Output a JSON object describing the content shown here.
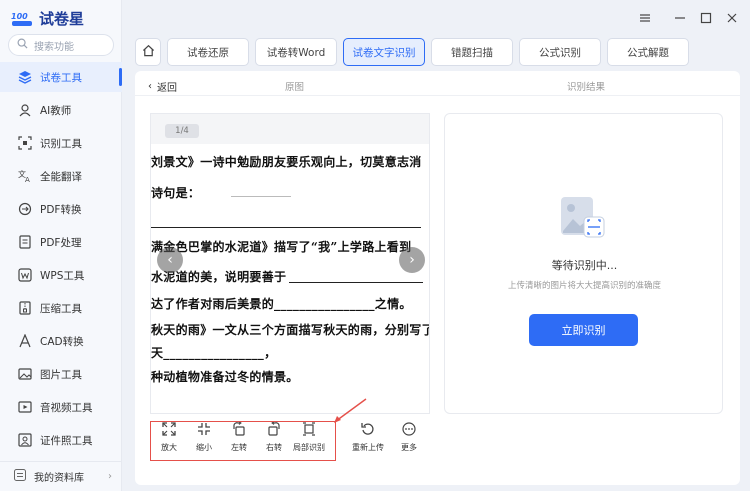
{
  "app": {
    "name": "试卷星",
    "logo_mark": "100"
  },
  "sidebar": {
    "search_placeholder": "搜索功能",
    "items": [
      {
        "label": "试卷工具",
        "icon": "layers-icon",
        "active": true
      },
      {
        "label": "AI教师",
        "icon": "ai-teacher-icon"
      },
      {
        "label": "识别工具",
        "icon": "scan-icon"
      },
      {
        "label": "全能翻译",
        "icon": "translate-icon"
      },
      {
        "label": "PDF转换",
        "icon": "pdf-convert-icon"
      },
      {
        "label": "PDF处理",
        "icon": "pdf-process-icon"
      },
      {
        "label": "WPS工具",
        "icon": "wps-icon"
      },
      {
        "label": "压缩工具",
        "icon": "compress-icon"
      },
      {
        "label": "CAD转换",
        "icon": "cad-icon"
      },
      {
        "label": "图片工具",
        "icon": "image-icon"
      },
      {
        "label": "音视频工具",
        "icon": "media-icon"
      },
      {
        "label": "证件照工具",
        "icon": "id-photo-icon"
      }
    ],
    "library": "我的资料库"
  },
  "tabs": [
    {
      "label": "试卷还原",
      "active": false
    },
    {
      "label": "试卷转Word",
      "active": false
    },
    {
      "label": "试卷文字识别",
      "active": true
    },
    {
      "label": "错题扫描",
      "active": false
    },
    {
      "label": "公式识别",
      "active": false
    },
    {
      "label": "公式解题",
      "active": false
    }
  ],
  "main": {
    "back_label": "返回",
    "original_label": "原图",
    "result_label": "识别结果",
    "page_indicator": "1/4",
    "document_lines": [
      "刘景文》一诗中勉励朋友要乐观向上，切莫意志消",
      "诗句是：",
      "",
      "满金色巴掌的水泥道》描写了“我”上学路上看到",
      "水泥道的美，说明要善于",
      "达了作者对雨后美景的________________之情。",
      "秋天的雨》一文从三个方面描写秋天的雨，分别写了",
      "天________________，",
      "种动植物准备过冬的情景。"
    ],
    "result": {
      "title": "等待识别中...",
      "subtitle": "上传清晰的图片将大大提高识别的准确度",
      "button": "立即识别"
    },
    "tools": [
      {
        "label": "放大",
        "icon": "zoom-in-icon"
      },
      {
        "label": "缩小",
        "icon": "zoom-out-icon"
      },
      {
        "label": "左转",
        "icon": "rotate-left-icon"
      },
      {
        "label": "右转",
        "icon": "rotate-right-icon"
      },
      {
        "label": "局部识别",
        "icon": "crop-icon"
      },
      {
        "label": "重新上传",
        "icon": "reupload-icon"
      },
      {
        "label": "更多",
        "icon": "more-icon"
      }
    ]
  },
  "colors": {
    "accent": "#2e6cf5",
    "highlight": "#e5504a"
  }
}
